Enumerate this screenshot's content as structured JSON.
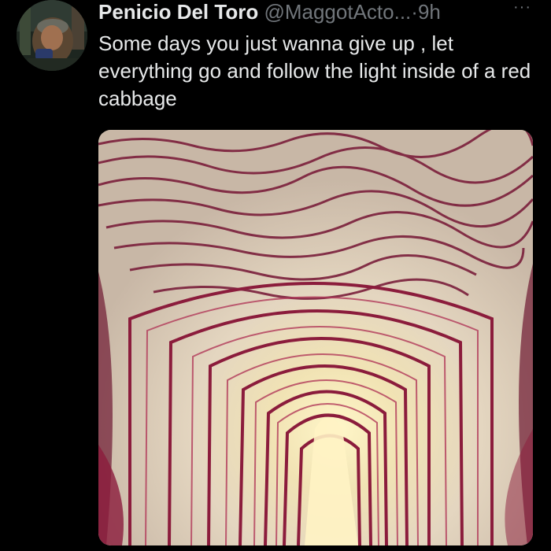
{
  "tweet": {
    "display_name": "Penicio Del Toro",
    "handle": "@MaggotActo...",
    "separator": "·",
    "time": "9h",
    "more_icon": "more-horizontal-icon",
    "text": "Some days you just wanna give up , let everything go and follow the light inside of a red cabbage"
  },
  "colors": {
    "background": "#000000",
    "text_primary": "#e7e9ea",
    "text_secondary": "#71767b"
  }
}
